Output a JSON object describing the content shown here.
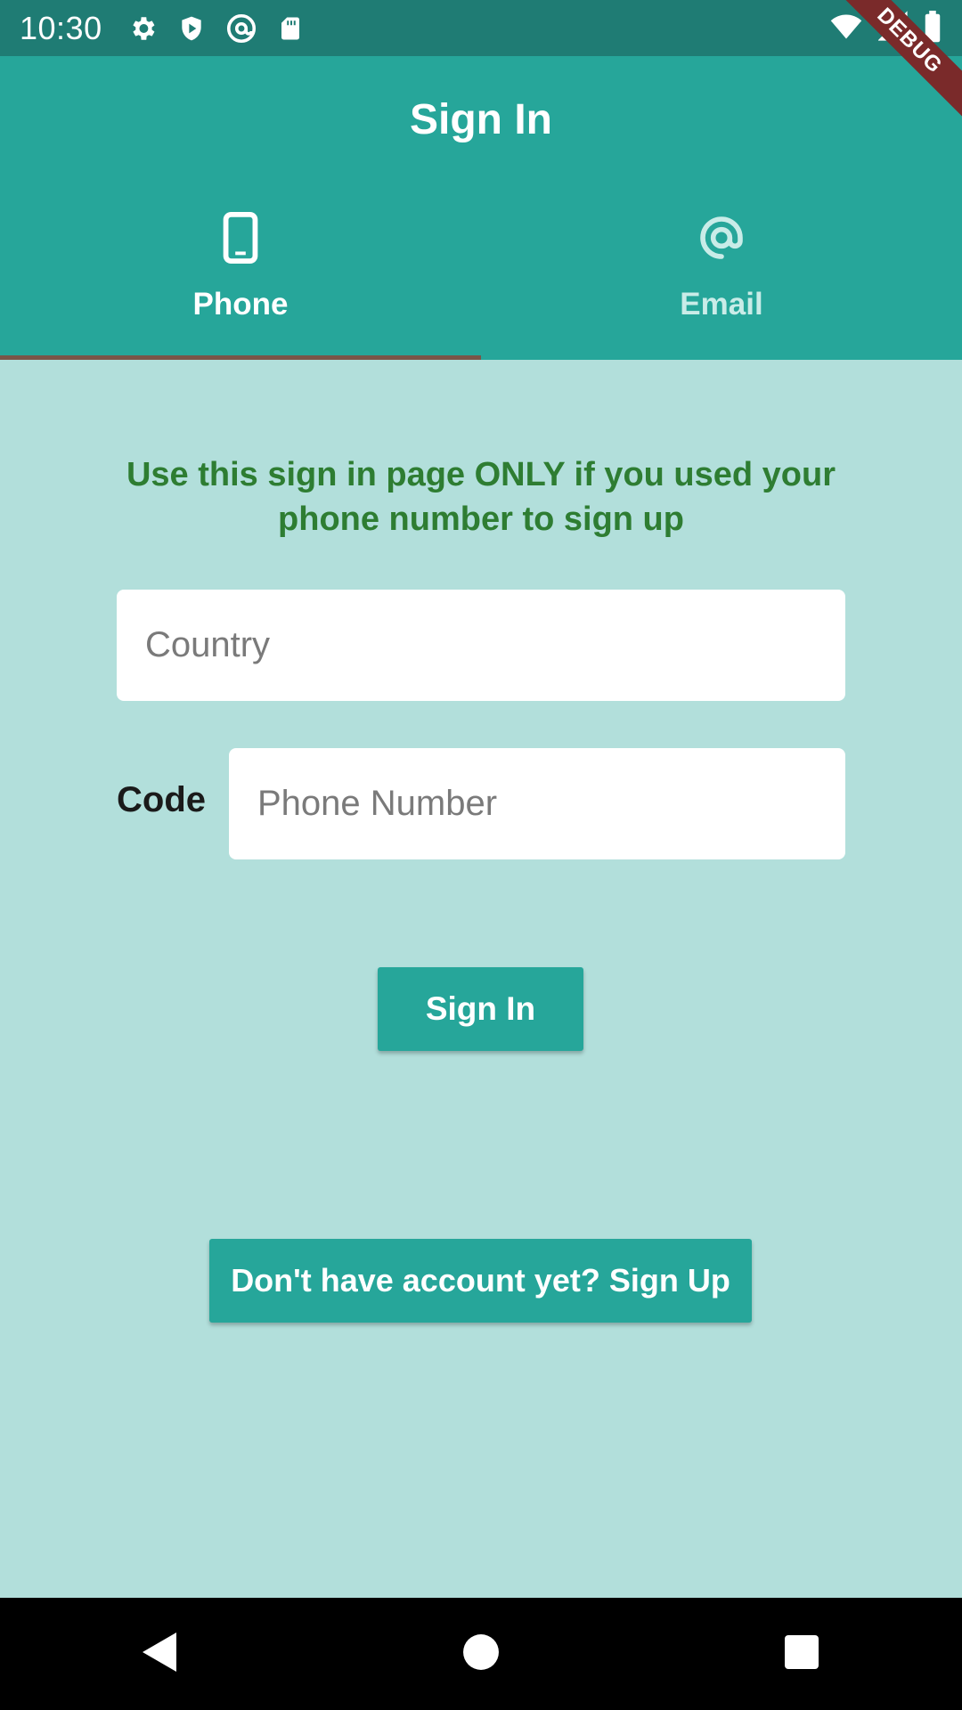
{
  "status_bar": {
    "time": "10:30",
    "left_icons": [
      "settings-icon",
      "shield-icon",
      "at-circle-icon",
      "sd-card-icon"
    ],
    "right_icons": [
      "wifi-icon",
      "signal-icon",
      "battery-icon"
    ]
  },
  "debug_banner": "DEBUG",
  "app_bar": {
    "title": "Sign In",
    "background": "#26a69a"
  },
  "tabs": [
    {
      "label": "Phone",
      "icon": "phone-icon",
      "selected": true
    },
    {
      "label": "Email",
      "icon": "at-icon",
      "selected": false
    }
  ],
  "main": {
    "notice": "Use this sign in page ONLY if you used your phone number to sign up",
    "country_input": {
      "placeholder": "Country",
      "value": ""
    },
    "code_label": "Code",
    "phone_input": {
      "placeholder": "Phone Number",
      "value": ""
    },
    "sign_in_button": "Sign In",
    "sign_up_button": "Don't have account yet? Sign Up"
  },
  "nav_bar": {
    "buttons": [
      "back-icon",
      "home-icon",
      "recents-icon"
    ]
  },
  "colors": {
    "accent": "#26a69a",
    "status_bar": "#1f7c74",
    "background": "#b2dfdb",
    "notice_text": "#2e7d32",
    "tab_indicator": "#795548"
  }
}
